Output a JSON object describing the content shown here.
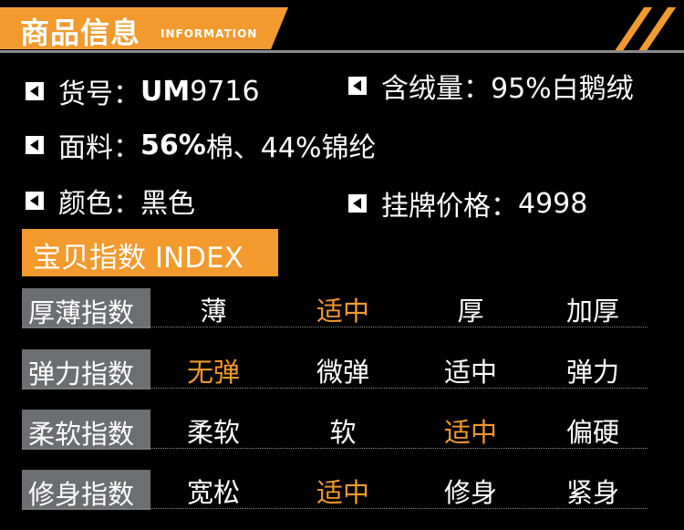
{
  "header": {
    "title": "商品信息",
    "subtitle": "INFORMATION",
    "accent_color": "#f29a2e"
  },
  "info": {
    "item_no": {
      "label": "货号：",
      "value": "UM",
      "value_tail": "9716"
    },
    "down_content": {
      "label": "含绒量：",
      "value": "95%白鹅绒"
    },
    "fabric": {
      "label": "面料：",
      "value_bold": "56%",
      "value": "棉、44%锦纶"
    },
    "color": {
      "label": "颜色：",
      "value": "黑色"
    },
    "price": {
      "label": "挂牌价格：",
      "value": "4998"
    }
  },
  "index": {
    "title": "宝贝指数 INDEX",
    "rows": [
      {
        "label": "厚薄指数",
        "options": [
          "薄",
          "适中",
          "厚",
          "加厚"
        ],
        "selected": 1
      },
      {
        "label": "弹力指数",
        "options": [
          "无弹",
          "微弹",
          "适中",
          "弹力"
        ],
        "selected": 0
      },
      {
        "label": "柔软指数",
        "options": [
          "柔软",
          "软",
          "适中",
          "偏硬"
        ],
        "selected": 2
      },
      {
        "label": "修身指数",
        "options": [
          "宽松",
          "适中",
          "修身",
          "紧身"
        ],
        "selected": 1
      }
    ]
  }
}
